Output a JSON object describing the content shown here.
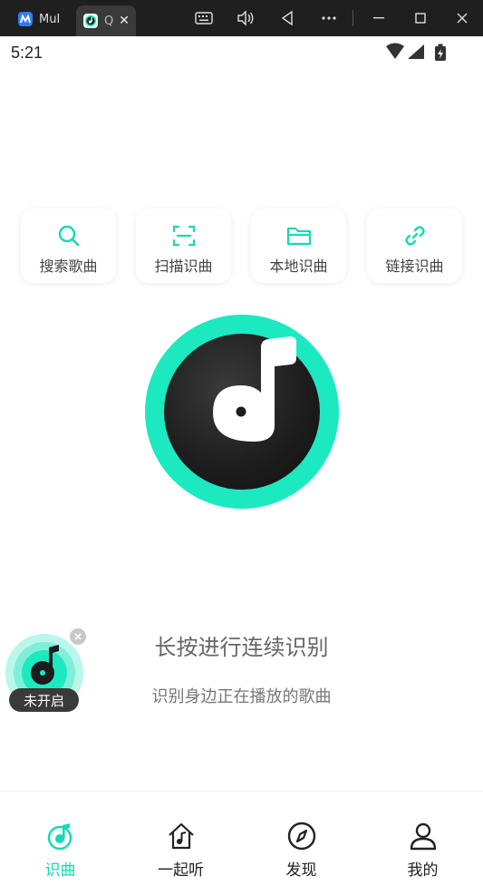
{
  "window": {
    "tabs": [
      {
        "label": "MuMu",
        "icon": "mumu-icon"
      },
      {
        "label": "Q",
        "icon": "app-icon",
        "close": "✕"
      }
    ],
    "controls": [
      "keyboard-icon",
      "volume-icon",
      "back-icon",
      "more-icon",
      "minimize-icon",
      "maximize-icon",
      "close-icon"
    ]
  },
  "status_bar": {
    "time": "5:21",
    "icons": [
      "wifi-icon",
      "signal-icon",
      "battery-charging-icon"
    ]
  },
  "actions": [
    {
      "label": "搜索歌曲",
      "icon": "search-icon"
    },
    {
      "label": "扫描识曲",
      "icon": "scan-icon"
    },
    {
      "label": "本地识曲",
      "icon": "folder-icon"
    },
    {
      "label": "链接识曲",
      "icon": "link-icon"
    }
  ],
  "main": {
    "hint_title": "长按进行连续识别",
    "hint_subtitle": "识别身边正在播放的歌曲"
  },
  "floating_widget": {
    "badge": "未开启"
  },
  "bottom_nav": [
    {
      "label": "识曲",
      "icon": "music-disc-icon",
      "active": true
    },
    {
      "label": "一起听",
      "icon": "music-house-icon",
      "active": false
    },
    {
      "label": "发现",
      "icon": "compass-icon",
      "active": false
    },
    {
      "label": "我的",
      "icon": "person-icon",
      "active": false
    }
  ],
  "colors": {
    "accent": "#1de9c1",
    "accent_text": "#16d9b4",
    "disc": "#1c1c1c",
    "chrome": "#1f1f1f"
  }
}
